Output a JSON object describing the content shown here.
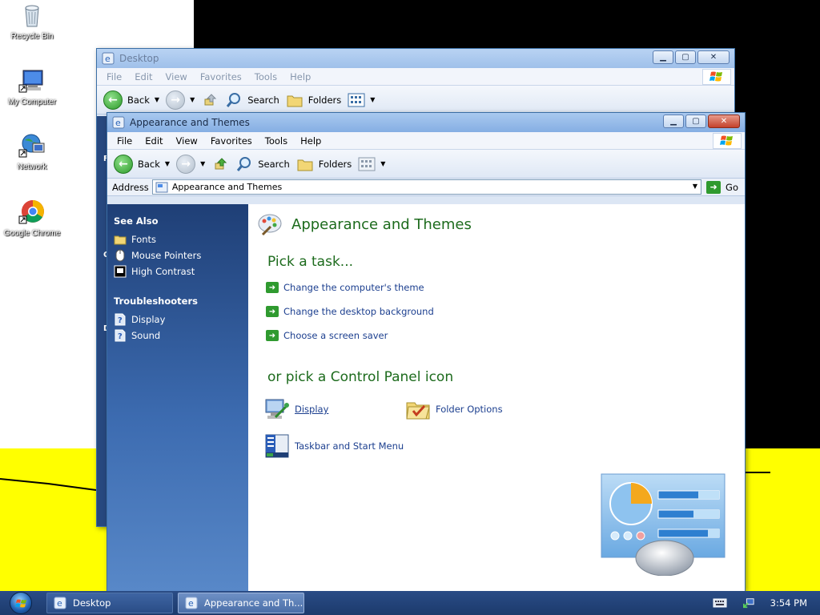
{
  "desktop": {
    "icons": [
      {
        "label": "Recycle Bin",
        "icon": "recycle-bin-icon"
      },
      {
        "label": "My Computer",
        "icon": "computer-icon"
      },
      {
        "label": "Network",
        "icon": "network-icon"
      },
      {
        "label": "Google Chrome",
        "icon": "chrome-icon"
      }
    ]
  },
  "back_window": {
    "title": "Desktop",
    "menu": [
      "File",
      "Edit",
      "View",
      "Favorites",
      "Tools",
      "Help"
    ],
    "toolbar": {
      "back": "Back",
      "search": "Search",
      "folders": "Folders"
    },
    "sidebar_fragments": [
      "F",
      "C",
      "D"
    ]
  },
  "window": {
    "title": "Appearance and Themes",
    "menu": [
      "File",
      "Edit",
      "View",
      "Favorites",
      "Tools",
      "Help"
    ],
    "toolbar": {
      "back": "Back",
      "search": "Search",
      "folders": "Folders"
    },
    "address": {
      "label": "Address",
      "value": "Appearance and Themes",
      "go": "Go"
    },
    "sidebar": {
      "see_also": {
        "title": "See Also",
        "items": [
          {
            "label": "Fonts",
            "icon": "folder-icon"
          },
          {
            "label": "Mouse Pointers",
            "icon": "mouse-icon"
          },
          {
            "label": "High Contrast",
            "icon": "contrast-icon"
          }
        ]
      },
      "troubleshooters": {
        "title": "Troubleshooters",
        "items": [
          {
            "label": "Display",
            "icon": "help-icon"
          },
          {
            "label": "Sound",
            "icon": "help-icon"
          }
        ]
      }
    },
    "main": {
      "heading": "Appearance and Themes",
      "pick_task": "Pick a task...",
      "tasks": [
        "Change the computer's theme",
        "Change the desktop background",
        "Choose a screen saver"
      ],
      "pick_icon": "or pick a Control Panel icon",
      "icons": [
        {
          "label": "Display",
          "icon": "display-icon"
        },
        {
          "label": "Folder Options",
          "icon": "folder-options-icon"
        },
        {
          "label": "Taskbar and Start Menu",
          "icon": "taskbar-icon"
        }
      ]
    }
  },
  "taskbar": {
    "buttons": [
      {
        "label": "Desktop",
        "active": false
      },
      {
        "label": "Appearance and Th...",
        "active": true
      }
    ],
    "clock": "3:54 PM"
  },
  "colors": {
    "accent_green": "#1d6b1d",
    "link_blue": "#1c3f8f",
    "sidebar_blue": "#1f3f76",
    "wallpaper_yellow": "#ffff00"
  }
}
